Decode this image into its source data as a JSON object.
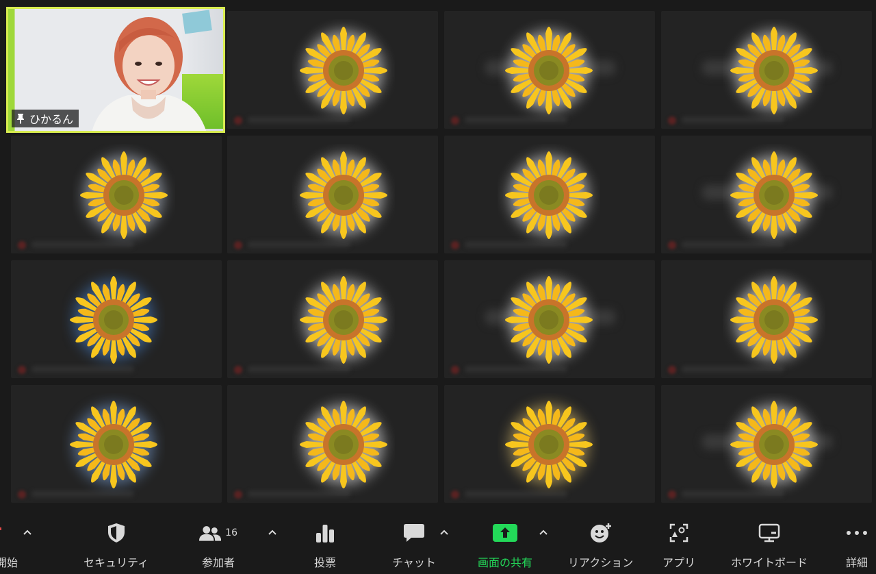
{
  "self_view": {
    "name": "ひかるん"
  },
  "participant_count_tiles": 15,
  "toolbar": {
    "start_label": "開始",
    "security_label": "セキュリティ",
    "participants_label": "参加者",
    "participants_count": "16",
    "polls_label": "投票",
    "chat_label": "チャット",
    "share_label": "画面の共有",
    "reactions_label": "リアクション",
    "apps_label": "アプリ",
    "whiteboard_label": "ホワイトボード",
    "more_label": "詳細"
  },
  "colors": {
    "background": "#1a1a1a",
    "tile": "#232323",
    "active_speaker_border": "#d8ec50",
    "share_green": "#23d959",
    "sunflower_petal": "#f7c61e",
    "sunflower_center": "#c8742a"
  },
  "icons": [
    "pin-icon",
    "shield-icon",
    "participants-icon",
    "polls-icon",
    "chat-icon",
    "share-screen-icon",
    "reaction-icon",
    "apps-icon",
    "whiteboard-icon",
    "more-icon",
    "caret-up-icon"
  ]
}
